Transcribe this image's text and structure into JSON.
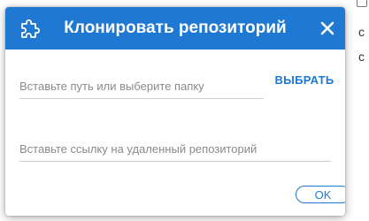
{
  "dialog": {
    "title": "Клонировать репозиторий",
    "header_icon": "puzzle-icon",
    "close_icon": "close-icon",
    "colors": {
      "header_bg": "#1f78d1",
      "accent": "#1f78d1"
    }
  },
  "fields": {
    "path": {
      "value": "",
      "placeholder": "Вставьте путь или выберите папку"
    },
    "url": {
      "value": "",
      "placeholder": "Вставьте ссылку на удаленный репозиторий"
    }
  },
  "buttons": {
    "choose_label": "ВЫБРАТЬ",
    "ok_label": "OK"
  },
  "background": {
    "letter_1": "с",
    "letter_2": "с"
  }
}
